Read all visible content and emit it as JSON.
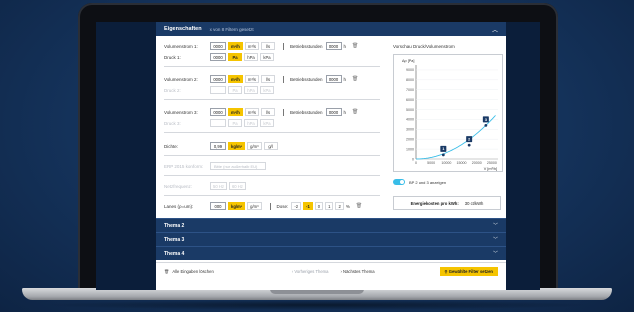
{
  "header": {
    "title": "Eigenschaften",
    "subtitle": "x von 8 Filtern gesetzt"
  },
  "rows": {
    "vol1": {
      "label": "Volumenstrom 1:",
      "value": "0000",
      "units": [
        "m³/h",
        "m³/s",
        "l/s"
      ],
      "bst_label": "Betriebsstunden",
      "bst_value": "0000",
      "bst_unit": "h"
    },
    "druck1": {
      "label": "Druck 1:",
      "value": "0000",
      "units": [
        "Pa",
        "hPa",
        "kPa"
      ]
    },
    "vol2": {
      "label": "Volumenstrom 2:",
      "value": "0000",
      "units": [
        "m³/h",
        "m³/s",
        "l/s"
      ],
      "bst_label": "Betriebsstunden",
      "bst_value": "0000",
      "bst_unit": "h"
    },
    "druck2": {
      "label": "Druck 2:",
      "value": "",
      "units": [
        "Pa",
        "hPa",
        "kPa"
      ]
    },
    "vol3": {
      "label": "Volumenstrom 3:",
      "value": "0000",
      "units": [
        "m³/h",
        "m³/s",
        "l/s"
      ],
      "bst_label": "Betriebsstunden",
      "bst_value": "0000",
      "bst_unit": "h"
    },
    "druck3": {
      "label": "Druck 3:",
      "value": "",
      "units": [
        "Pa",
        "hPa",
        "kPa"
      ]
    },
    "dichte": {
      "label": "Dichte:",
      "value": "0,99",
      "units": [
        "kg/m³",
        "g/m³",
        "g/l"
      ]
    },
    "erp": {
      "label": "ERP 2015 konform:",
      "placeholder": "Bitte (nur außerhalb EU)"
    },
    "netz": {
      "label": "Netzfrequenz:",
      "units": [
        "50 Hz",
        "60 Hz"
      ]
    },
    "lanes": {
      "label": "Lanes (ρ=um):",
      "value": "000",
      "units": [
        "kg/m³",
        "g/m³"
      ],
      "dose_label": "Dose:",
      "options": [
        "-2",
        "-1",
        "0",
        "1",
        "2"
      ],
      "suffix": "%"
    }
  },
  "chart": {
    "title": "Vorschau Druck/Volumenstrom",
    "toggle_label": "BP 2 und 3 anzeigen",
    "energy_label": "Energiekosten pro kWh:",
    "energy_value": "30 ct/kWh"
  },
  "chart_data": {
    "type": "scatter",
    "title": "Vorschau Druck/Volumenstrom",
    "ylabel": "Δp [Pa]",
    "xlabel": "V [m³/h]",
    "xticks": [
      "0",
      "5000",
      "10000",
      "15000",
      "20000",
      "25000"
    ],
    "yticks": [
      "0",
      "1000",
      "2000",
      "3000",
      "4000",
      "5000",
      "6000",
      "7000",
      "8000",
      "9000"
    ],
    "xlim": [
      0,
      27000
    ],
    "ylim": [
      0,
      9500
    ],
    "points": [
      {
        "label": "1",
        "x": 9000,
        "y": 420
      },
      {
        "label": "2",
        "x": 17500,
        "y": 1400
      },
      {
        "label": "3",
        "x": 23000,
        "y": 3400
      }
    ],
    "curve_color": "#38bde8"
  },
  "accordions": [
    "Thema 2",
    "Thema 3",
    "Thema 4"
  ],
  "footer": {
    "clear": "Alle Eingaben löschen",
    "prev": "Vorheriges Thema",
    "next": "Nächstes Thema",
    "apply": "Gewählte Filter setzen"
  },
  "colors": {
    "accent": "#f5c400",
    "navy": "#1a3a66",
    "toggle": "#38bde8"
  }
}
